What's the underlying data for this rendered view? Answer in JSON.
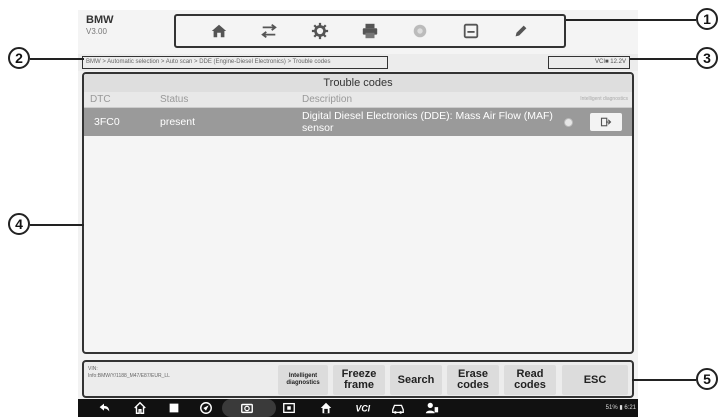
{
  "app": {
    "name": "BMW",
    "version": "V3.00"
  },
  "toolbar": {
    "items": [
      {
        "name": "home",
        "icon": "home-icon"
      },
      {
        "name": "vehicle-swap",
        "icon": "vehicle-swap-icon"
      },
      {
        "name": "settings",
        "icon": "gear-icon"
      },
      {
        "name": "print",
        "icon": "printer-icon"
      },
      {
        "name": "help",
        "icon": "help-icon"
      },
      {
        "name": "save",
        "icon": "save-icon"
      },
      {
        "name": "data-logging",
        "icon": "pencil-icon"
      }
    ]
  },
  "breadcrumb": "BMW > Automatic selection > Auto scan > DDE (Engine-Diesel Electronics) > Trouble codes",
  "vci_status": "VCI■ 12.2V",
  "panel": {
    "title": "Trouble codes",
    "columns": {
      "dtc": "DTC",
      "status": "Status",
      "description": "Description",
      "intelligent": "Intelligent diagnostics"
    },
    "rows": [
      {
        "dtc": "3FC0",
        "status": "present",
        "description": "Digital Diesel Electronics (DDE): Mass Air Flow (MAF) sensor"
      }
    ]
  },
  "vehicle_info": "VIN:\nInfo:BMW/Y/1188_M47/E87/EUR_LL",
  "actions": {
    "intelligent": "Intelligent diagnostics",
    "freeze": "Freeze frame",
    "search": "Search",
    "erase": "Erase codes",
    "read": "Read codes",
    "esc": "ESC"
  },
  "navbar": {
    "icons": [
      "back-icon",
      "home-icon",
      "recent-apps-icon",
      "browser-icon",
      "camera-icon",
      "screen-mirror-icon",
      "maxifix-home-icon",
      "vci-icon",
      "vehicle-icon",
      "user-icon"
    ],
    "status": "51% ▮ 6:21"
  },
  "callouts": [
    "1",
    "2",
    "3",
    "4",
    "5"
  ],
  "colors": {
    "selected_row": "#9a9a9a",
    "callout_border": "#222222",
    "navbar": "#111111"
  }
}
